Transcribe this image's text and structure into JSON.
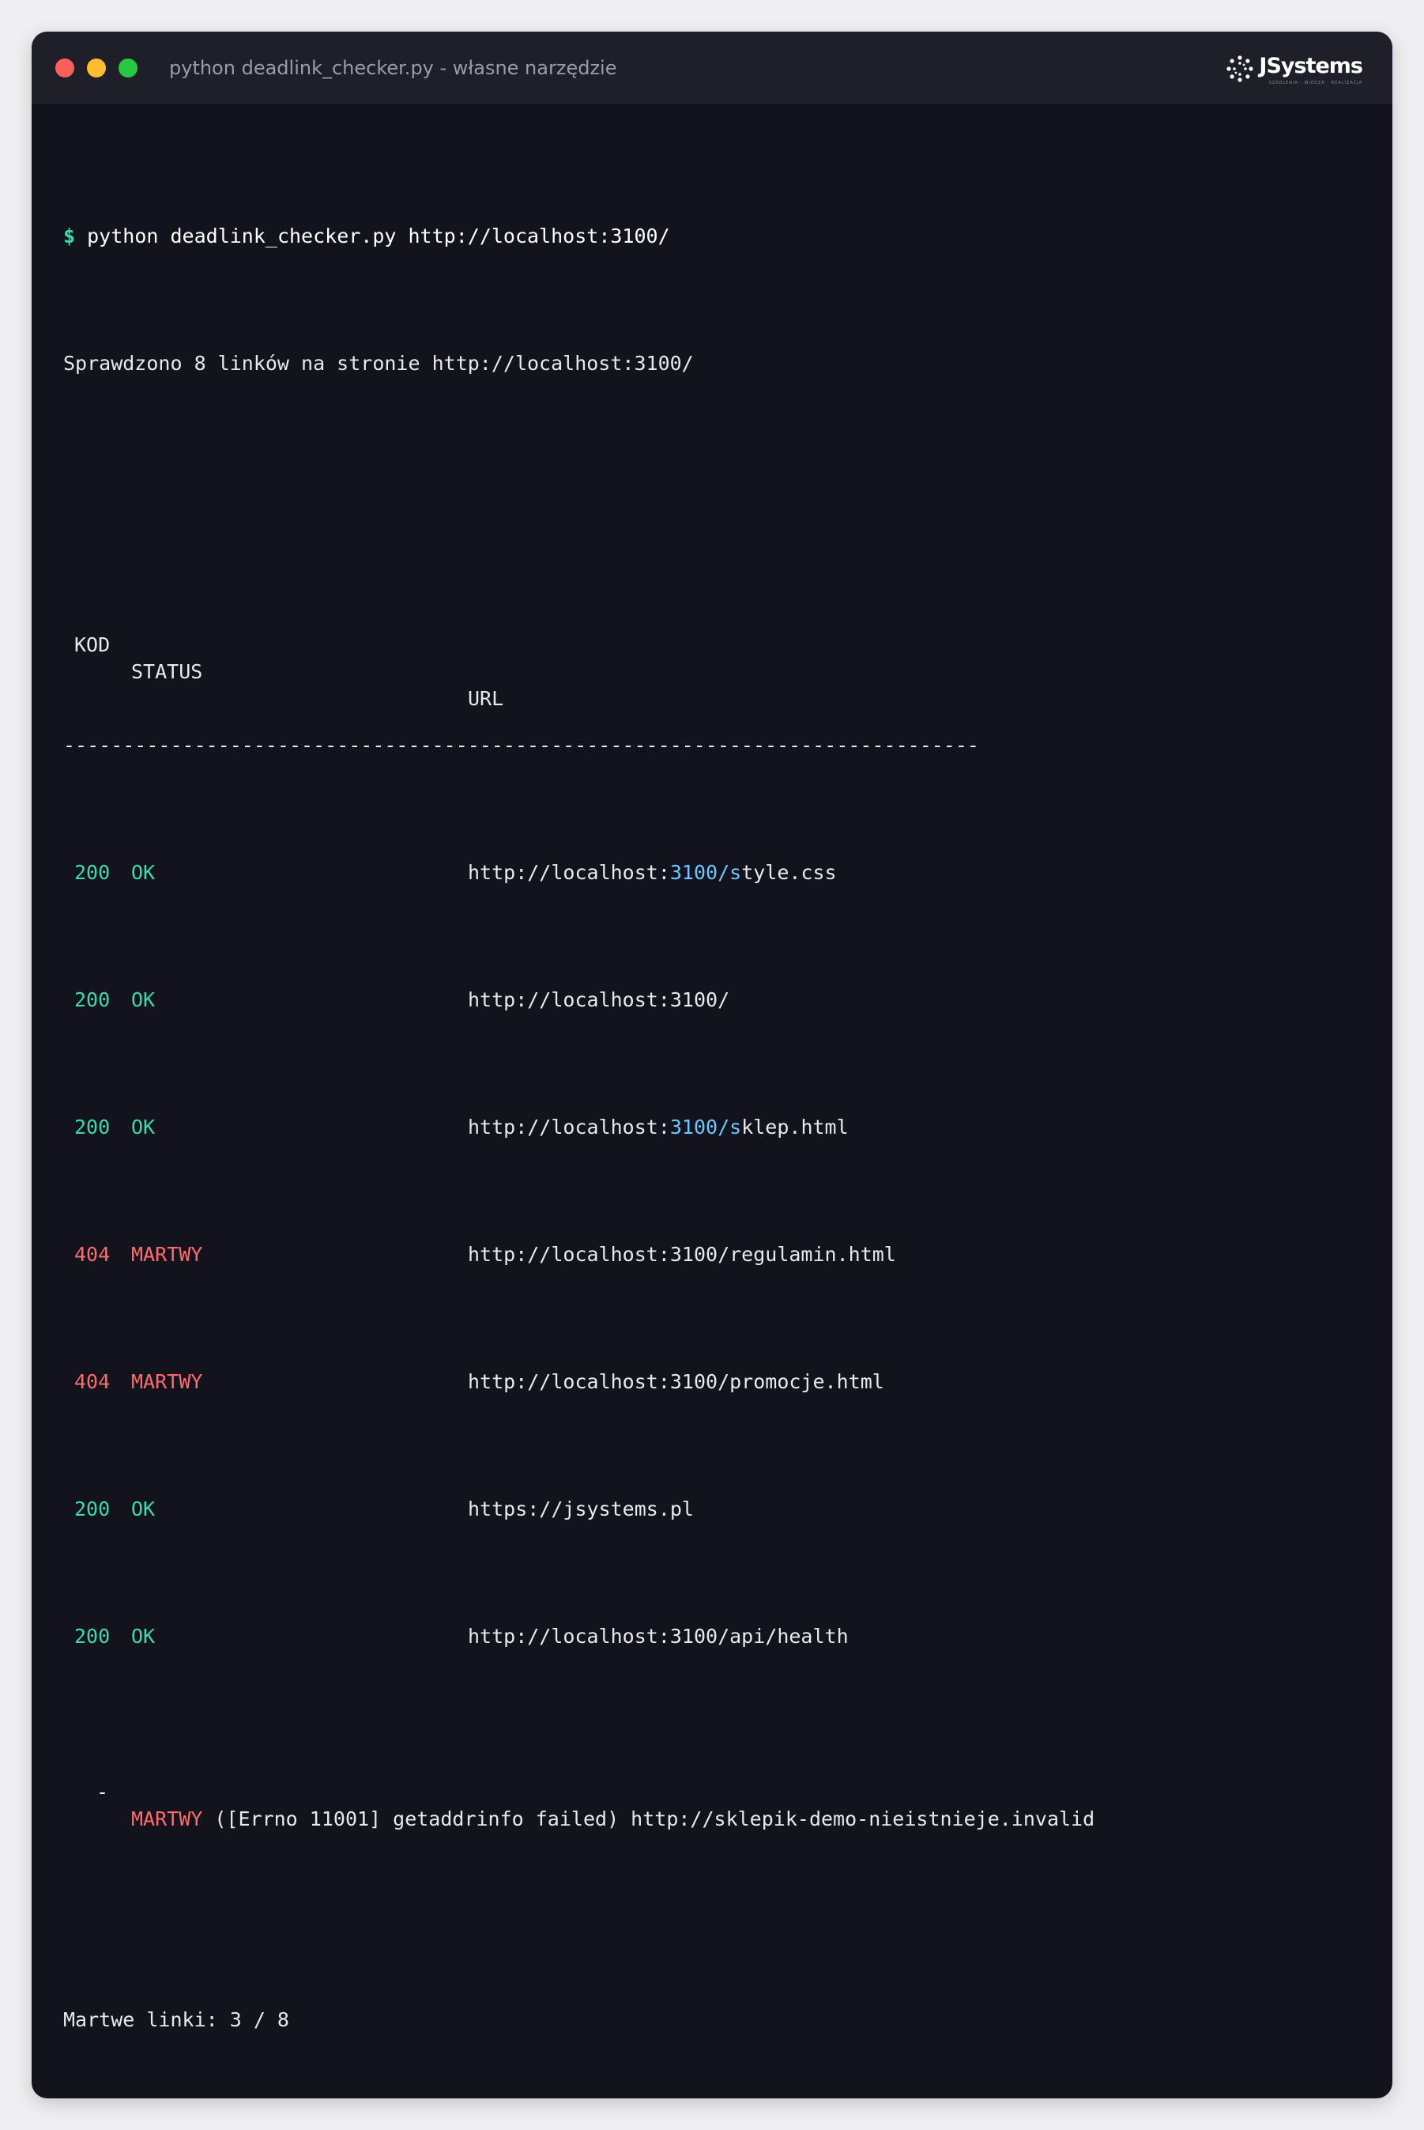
{
  "window": {
    "title": "python deadlink_checker.py - własne narzędzie",
    "logo": "JSystems",
    "logo_sub": "SZKOLENIA · WIEDZA · REALIZACJA"
  },
  "terminal": {
    "prompt": "$",
    "command": "python deadlink_checker.py http://localhost:3100/",
    "summary_line": "Sprawdzono 8 linków na stronie http://localhost:3100/",
    "headers": {
      "code": "KOD",
      "status": "STATUS",
      "url": "URL"
    },
    "separator": "-----------------------------------------------------------------------------",
    "rows": [
      {
        "code": "200",
        "status": "OK",
        "url_pre": "http://localhost:",
        "url_hl": "3100/s",
        "url_post": "tyle.css"
      },
      {
        "code": "200",
        "status": "OK",
        "url_pre": "http://localhost:3100/",
        "url_hl": "",
        "url_post": ""
      },
      {
        "code": "200",
        "status": "OK",
        "url_pre": "http://localhost:",
        "url_hl": "3100/s",
        "url_post": "klep.html"
      },
      {
        "code": "404",
        "status": "MARTWY",
        "url_pre": "http://localhost:3100/regulamin.html",
        "url_hl": "",
        "url_post": ""
      },
      {
        "code": "404",
        "status": "MARTWY",
        "url_pre": "http://localhost:3100/promocje.html",
        "url_hl": "",
        "url_post": ""
      },
      {
        "code": "200",
        "status": "OK",
        "url_pre": "https://jsystems.pl",
        "url_hl": "",
        "url_post": ""
      },
      {
        "code": "200",
        "status": "OK",
        "url_pre": "http://localhost:3100/api/health",
        "url_hl": "",
        "url_post": ""
      }
    ],
    "error_row": {
      "dash": "-",
      "status": "MARTWY",
      "message": "([Errno 11001] getaddrinfo failed) http://sklepik-demo-nieistnieje.invalid"
    },
    "footer": "Martwe linki: 3 / 8"
  },
  "colors": {
    "ok": "#3fd7b0",
    "dead": "#ff6b6b",
    "highlight": "#6fc6ff",
    "background": "#12131c",
    "titlebar": "#1e1f29"
  }
}
